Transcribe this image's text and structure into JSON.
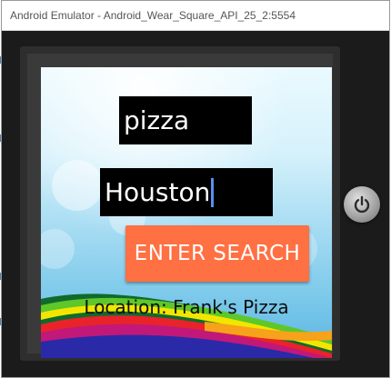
{
  "window": {
    "title": "Android Emulator - Android_Wear_Square_API_25_2:5554"
  },
  "app": {
    "query_value": "pizza",
    "location_value": "Houston",
    "enter_button_label": "ENTER SEARCH",
    "result_text": "Location: Frank's Pizza"
  },
  "icons": {
    "power": "power-icon"
  },
  "colors": {
    "button": "#ff7043",
    "field_bg": "#000000",
    "cursor": "#5a8ff0"
  }
}
